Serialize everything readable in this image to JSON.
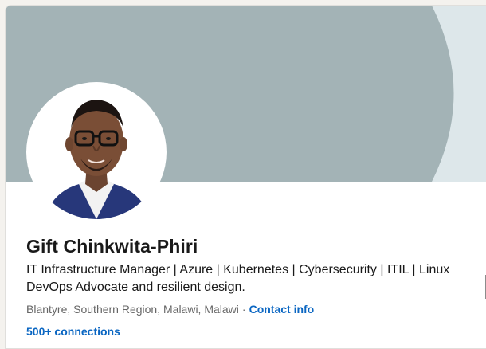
{
  "profile": {
    "name": "Gift Chinkwita-Phiri",
    "headline": "IT Infrastructure Manager | Azure | Kubernetes | Cybersecurity | ITIL | Linux DevOps Advocate and resilient design.",
    "location": "Blantyre, Southern Region, Malawi, Malawi",
    "separator": "·",
    "contact_label": "Contact info",
    "connections_label": "500+ connections"
  },
  "colors": {
    "cover_background": "#dde7ea",
    "cover_shape": "#a3b3b6",
    "link": "#0a66c2",
    "text_primary": "#191919",
    "text_secondary": "#666666"
  },
  "icons": {
    "avatar": "profile-photo"
  }
}
